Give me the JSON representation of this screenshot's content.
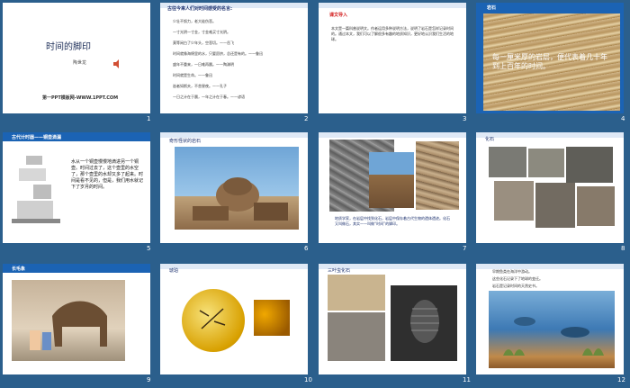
{
  "slides": [
    {
      "number": "1",
      "title": "时间的脚印",
      "author": "陶世龙",
      "footer": "第一PPT模板网-WWW.1PPT.COM"
    },
    {
      "number": "2",
      "bullets": [
        "古往今来人们对时间感受的名言:",
        "少壮不努力，老大徒伤悲。",
        "一寸光阴一寸金，寸金难买寸光阴。",
        "莫等闲白了少年头，空悲切。——岳飞",
        "时间就像海绵里的水，只要愿挤，总还是有的。——鲁迅",
        "盛年不重来，一日难再晨。——陶渊明",
        "时间就是生命。——鲁迅",
        "逝者如斯夫，不舍昼夜。——孔子",
        "一日之计在于晨，一年之计在于春。——谚语"
      ]
    },
    {
      "number": "3",
      "header": "课文导入",
      "body": "本文是一篇科普说明文。作者运用多种说明方法，说明了岩石是怎样记录时间的。通过本文，我们可以了解很多有趣的地质知识，更好地认识我们生活的地球。"
    },
    {
      "number": "4",
      "header": "岩石",
      "overlay": "每一厘米厚的岩层，便代表着几十年到上百年的时间。"
    },
    {
      "number": "5",
      "header": "古代计时器——铜壶滴漏",
      "body": "水从一个铜壶慢慢地滴进另一个铜壶。时间过去了，这个壶里的水空了，那个壶里的水却又多了起来。时间是看不见的，但是，我们用水就记下了岁月的时间。"
    },
    {
      "number": "6",
      "header": "奇形怪状的岩石"
    },
    {
      "number": "7",
      "caption": "地质学家，在岩层中找到化石，岩层中保存着古代生物的遗体遗迹。化石又叫做石，其实——叫做“时间”的脚印。"
    },
    {
      "number": "8",
      "header": "化石"
    },
    {
      "number": "9",
      "header": "长毛象"
    },
    {
      "number": "10",
      "header": "琥珀"
    },
    {
      "number": "11",
      "header": "三叶虫化石"
    },
    {
      "number": "12",
      "bullets": [
        "早期鱼类在海洋中游动。",
        "这些化石记录下了地球的变迁。",
        "岩石是记录时间的天然史书。"
      ]
    }
  ]
}
